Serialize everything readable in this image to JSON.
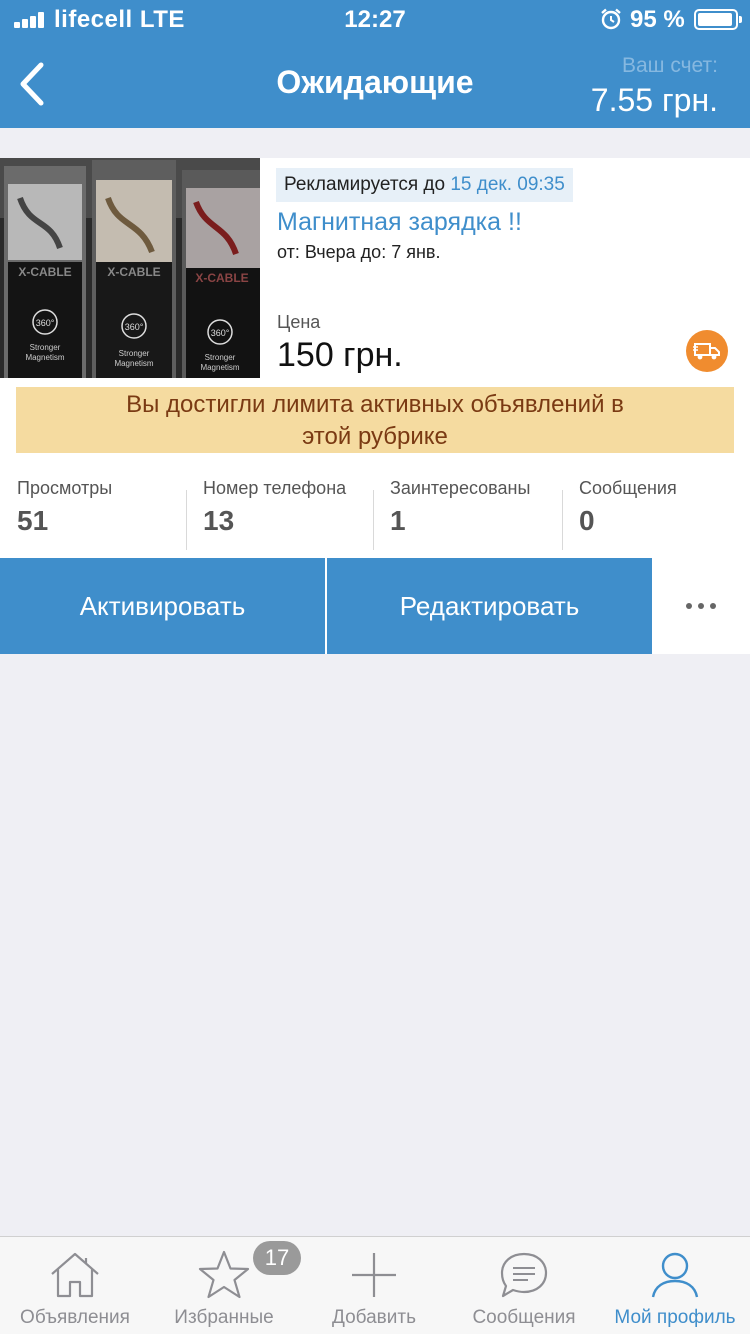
{
  "status_bar": {
    "carrier": "lifecell LTE",
    "time": "12:27",
    "battery": "95 %"
  },
  "nav": {
    "title": "Ожидающие",
    "account_label": "Ваш счет:",
    "account_value": "7.55 грн."
  },
  "listing": {
    "photo_icon": "product-photo-cables",
    "photo_text": {
      "brand": "X-CABLE",
      "feature": "360°",
      "tagline_1": "Stronger",
      "tagline_2": "Magnetism"
    },
    "promo_prefix": "Рекламируется до",
    "promo_date": "15 дек. 09:35",
    "title": "Магнитная зарядка !!",
    "dates": "от: Вчера до: 7 янв.",
    "price_label": "Цена",
    "price": "150 грн.",
    "delivery_icon": "delivery-truck-icon",
    "limit_line_1": "Вы достигли лимита активных объявлений в",
    "limit_line_2": "этой рубрике"
  },
  "stats": [
    {
      "label": "Просмотры",
      "value": "51"
    },
    {
      "label": "Номер телефона",
      "value": "13"
    },
    {
      "label": "Заинтересованы",
      "value": "1"
    },
    {
      "label": "Сообщения",
      "value": "0"
    }
  ],
  "actions": {
    "activate": "Активировать",
    "edit": "Редактировать",
    "more_icon": "more-dots-icon"
  },
  "tabs": [
    {
      "label": "Объявления",
      "icon": "home-icon"
    },
    {
      "label": "Избранные",
      "icon": "star-icon",
      "badge": "17"
    },
    {
      "label": "Добавить",
      "icon": "plus-icon"
    },
    {
      "label": "Сообщения",
      "icon": "chat-icon"
    },
    {
      "label": "Мой профиль",
      "icon": "profile-icon",
      "active": true
    }
  ],
  "colors": {
    "brand_blue": "#3f8ecb",
    "warning_bg": "#f5dba0",
    "warning_text": "#7a3a13",
    "delivery_orange": "#f08c2f"
  }
}
